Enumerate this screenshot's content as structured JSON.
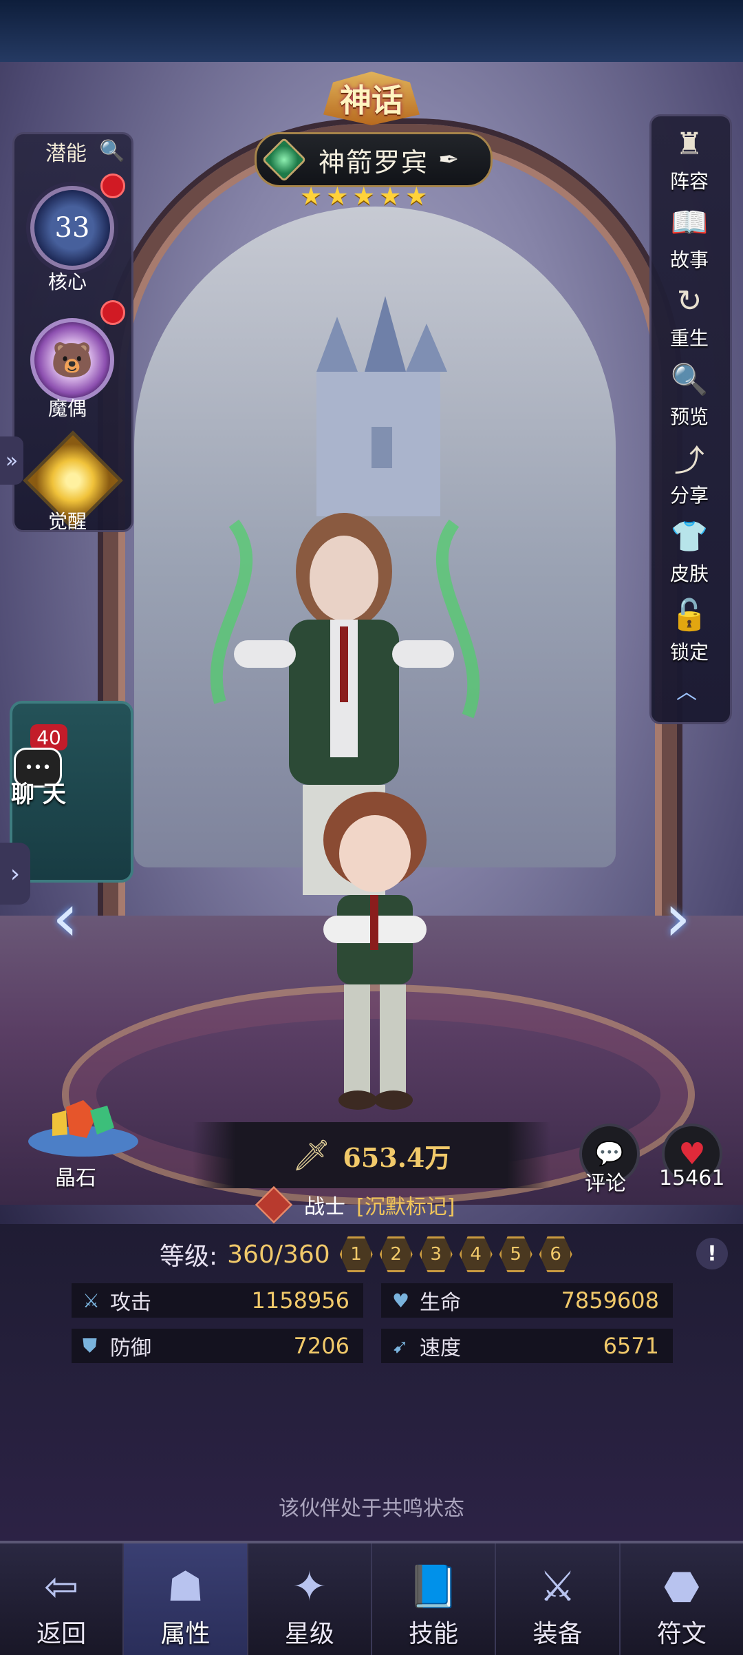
{
  "header": {
    "rarity_label": "神话",
    "hero_name": "神箭罗宾",
    "stars": 5
  },
  "left_panel": {
    "potential_label": "潜能",
    "core": {
      "level": "33",
      "label": "核心"
    },
    "puppet": {
      "label": "魔偶"
    },
    "awaken": {
      "label": "觉醒"
    }
  },
  "right_menu": [
    {
      "label": "阵容",
      "icon": "lineup-icon"
    },
    {
      "label": "故事",
      "icon": "story-book-icon"
    },
    {
      "label": "重生",
      "icon": "rebirth-icon"
    },
    {
      "label": "预览",
      "icon": "magnifier-icon"
    },
    {
      "label": "分享",
      "icon": "share-icon"
    },
    {
      "label": "皮肤",
      "icon": "skin-icon"
    },
    {
      "label": "锁定",
      "icon": "lock-icon"
    }
  ],
  "chat": {
    "badge": "40",
    "label": "聊 天"
  },
  "crystal": {
    "label": "晶石"
  },
  "power": {
    "value": "653.4万"
  },
  "social": {
    "comment_label": "评论",
    "like_count": "15461"
  },
  "class_info": {
    "class": "战士",
    "trait": "[沉默标记]"
  },
  "level": {
    "label": "等级:",
    "value": "360/360",
    "stages": [
      "1",
      "2",
      "3",
      "4",
      "5",
      "6"
    ]
  },
  "stats": {
    "attack": {
      "label": "攻击",
      "value": "1158956"
    },
    "hp": {
      "label": "生命",
      "value": "7859608"
    },
    "defense": {
      "label": "防御",
      "value": "7206"
    },
    "speed": {
      "label": "速度",
      "value": "6571"
    }
  },
  "status_text": "该伙伴处于共鸣状态",
  "bottom_nav": [
    {
      "label": "返回",
      "icon": "back-icon"
    },
    {
      "label": "属性",
      "icon": "attributes-icon",
      "active": true
    },
    {
      "label": "星级",
      "icon": "star-level-icon"
    },
    {
      "label": "技能",
      "icon": "skill-book-icon"
    },
    {
      "label": "装备",
      "icon": "equipment-icon"
    },
    {
      "label": "符文",
      "icon": "rune-icon"
    }
  ],
  "colors": {
    "gold": "#f1c96a",
    "panel": "#1a1930",
    "accent_blue": "#7ab3dd"
  }
}
